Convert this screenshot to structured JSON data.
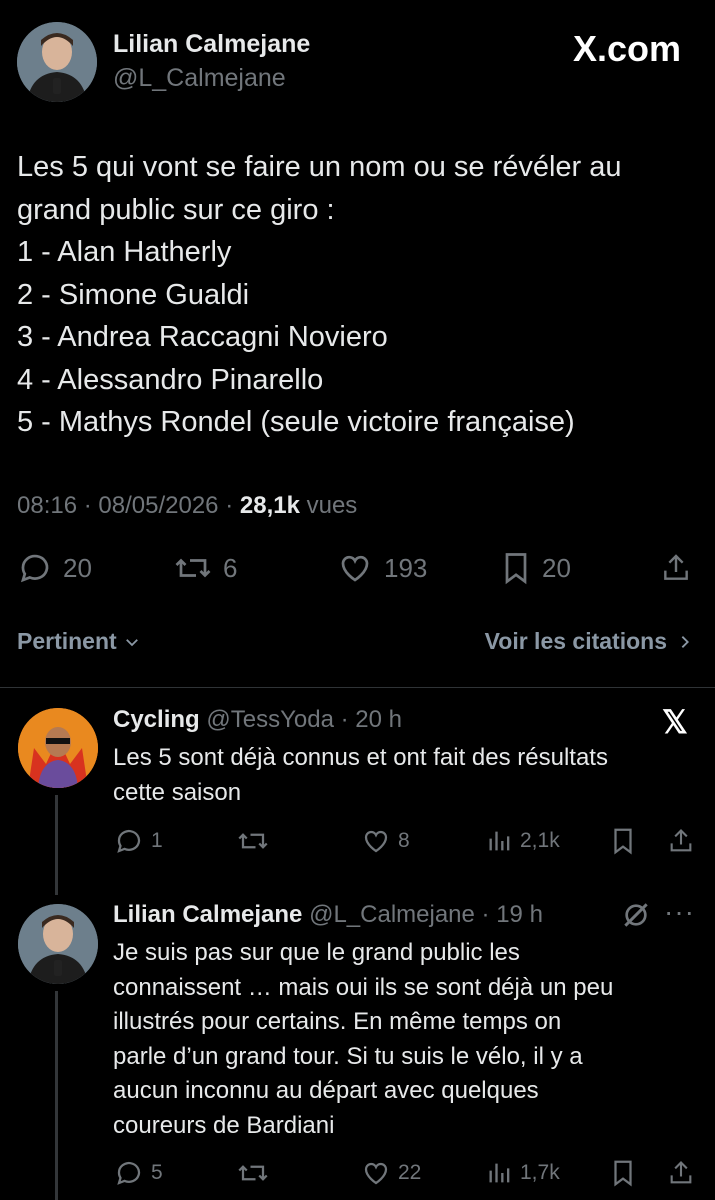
{
  "header": {
    "name": "Lilian Calmejane",
    "handle": "@L_Calmejane",
    "brand": "X.com"
  },
  "tweet": {
    "lines": [
      "Les 5 qui vont se faire un nom ou se révéler au",
      "grand public sur ce giro :",
      "1 - Alan Hatherly",
      "2 - Simone Gualdi",
      "3 - Andrea Raccagni Noviero",
      "4 - Alessandro Pinarello",
      "5 - Mathys Rondel (seule victoire française)"
    ],
    "time": "08:16",
    "date": "08/05/2026",
    "views": "28,1k",
    "views_label": "vues",
    "replies": "20",
    "retweets": "6",
    "likes": "193",
    "bookmarks": "20"
  },
  "sort_bar": {
    "left": "Pertinent",
    "right": "Voir les citations"
  },
  "reply1": {
    "name": "Cycling",
    "handle": "@TessYoda",
    "time": "· 20 h",
    "lines": [
      "Les 5 sont déjà connus et ont fait des résultats",
      "cette saison"
    ],
    "replies": "1",
    "likes": "8",
    "views": "2,1k"
  },
  "reply2": {
    "name": "Lilian Calmejane",
    "handle": "@L_Calmejane",
    "time": "· 19 h",
    "lines": [
      "Je suis pas sur que le grand public les",
      "connaissent … mais oui ils se sont déjà un peu",
      "illustrés pour certains. En même temps on",
      "parle d’un grand tour. Si tu suis le vélo, il y a",
      "aucun inconnu au départ avec quelques",
      "coureurs de Bardiani"
    ],
    "replies": "5",
    "likes": "22",
    "views": "1,7k"
  },
  "colors": {
    "background": "#000000",
    "text": "#e7e9ea",
    "muted": "#71767b",
    "divider": "#2f3336"
  }
}
